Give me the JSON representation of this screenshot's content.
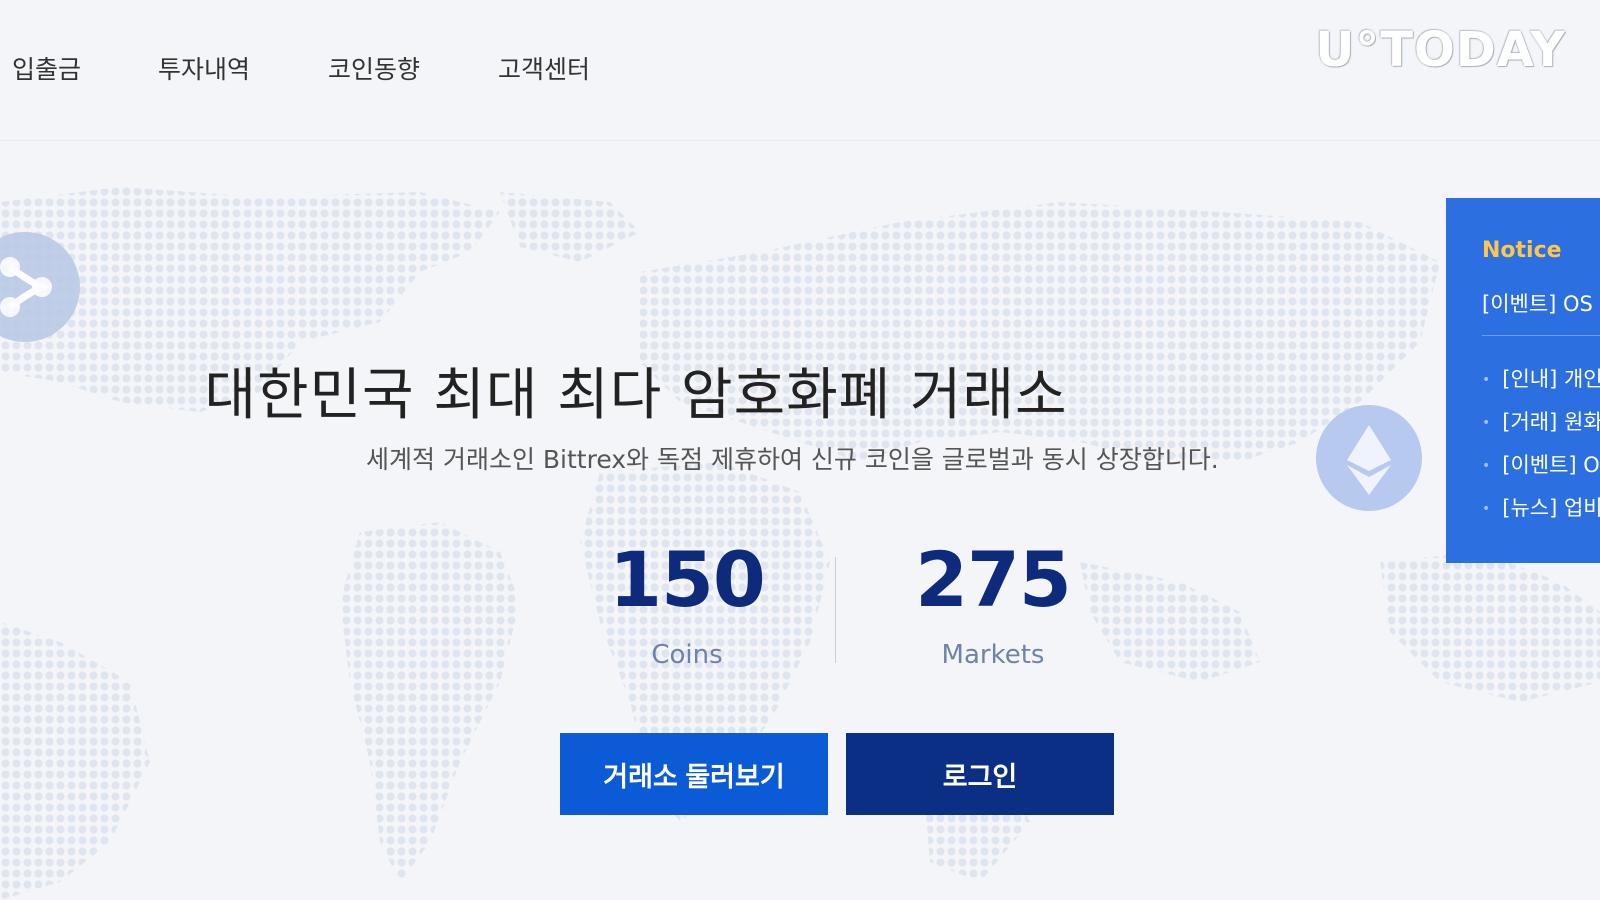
{
  "nav": {
    "items": [
      {
        "label": "입출금"
      },
      {
        "label": "투자내역"
      },
      {
        "label": "코인동향"
      },
      {
        "label": "고객센터"
      }
    ]
  },
  "watermark": "U°TODAY",
  "hero": {
    "title": "대한민국 최대 최다 암호화폐 거래소",
    "subtitle": "세계적 거래소인 Bittrex와 독점 제휴하여 신규 코인을 글로벌과 동시 상장합니다.",
    "stats": [
      {
        "value": "150",
        "label": "Coins"
      },
      {
        "value": "275",
        "label": "Markets"
      }
    ],
    "buttons": {
      "explore": "거래소 둘러보기",
      "login": "로그인"
    }
  },
  "notice": {
    "title": "Notice",
    "main": "[이벤트] OS",
    "items": [
      {
        "text": "[인내] 개인"
      },
      {
        "text": "[거래] 원화"
      },
      {
        "text": "[이벤트] O"
      },
      {
        "text": "[뉴스] 업비"
      }
    ]
  },
  "colors": {
    "accent": "#0b5bd6",
    "dark_accent": "#0c2f86",
    "notice_bg": "#2c6fe0",
    "notice_title": "#ffc64d",
    "stat_number": "#0e2a7a"
  },
  "icons": [
    "ripple-coin-icon",
    "ethereum-coin-icon",
    "bullet-dot-icon"
  ]
}
